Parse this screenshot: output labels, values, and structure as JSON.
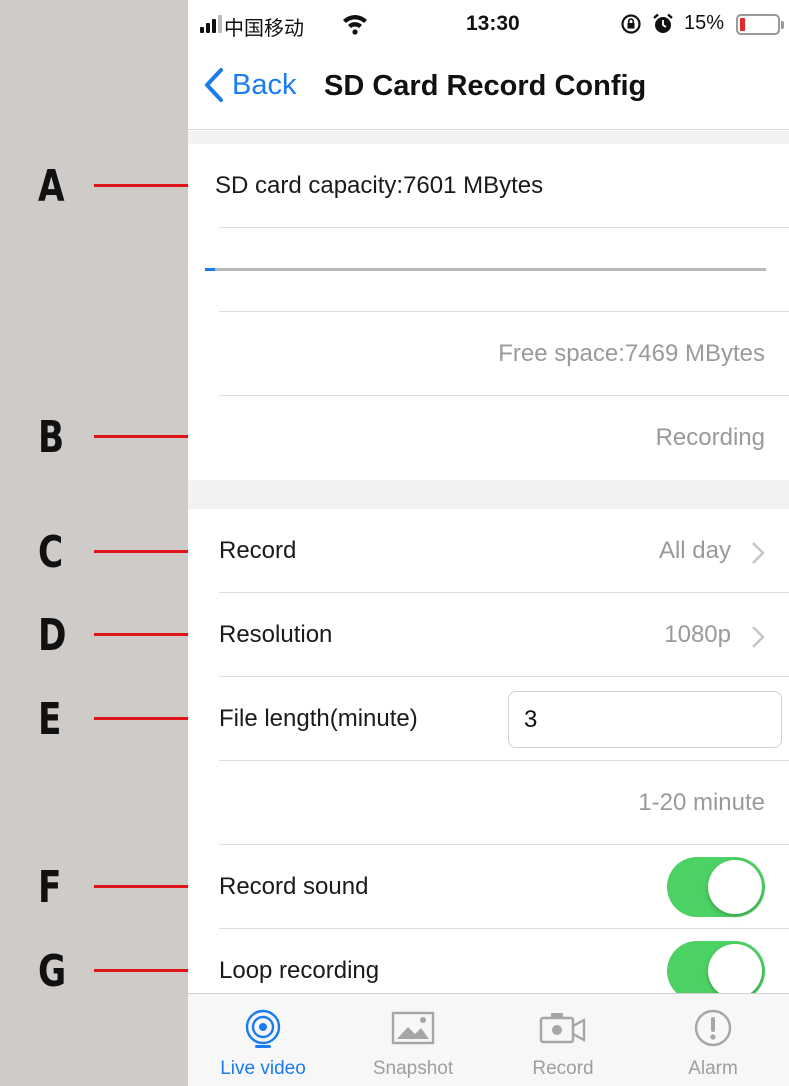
{
  "annotations": [
    "A",
    "B",
    "C",
    "D",
    "E",
    "F",
    "G"
  ],
  "status_bar": {
    "carrier": "中国移动",
    "time": "13:30",
    "battery": "15%"
  },
  "nav": {
    "back_label": "Back",
    "title": "SD Card Record Config"
  },
  "storage": {
    "capacity_label": "SD card capacity:7601 MBytes",
    "used_fraction": 0.017,
    "free_space_label": "Free space:7469 MBytes",
    "status_label": "Recording"
  },
  "settings": {
    "record": {
      "label": "Record",
      "value": "All day"
    },
    "resolution": {
      "label": "Resolution",
      "value": "1080p"
    },
    "file_length": {
      "label": "File length(minute)",
      "value": "3",
      "hint": "1-20 minute"
    },
    "record_sound": {
      "label": "Record sound",
      "on": true
    },
    "loop_recording": {
      "label": "Loop recording",
      "on": true
    }
  },
  "tabs": [
    {
      "label": "Live video",
      "icon": "live-video-icon",
      "active": true
    },
    {
      "label": "Snapshot",
      "icon": "snapshot-icon",
      "active": false
    },
    {
      "label": "Record",
      "icon": "record-camera-icon",
      "active": false
    },
    {
      "label": "Alarm",
      "icon": "alarm-icon",
      "active": false
    }
  ],
  "colors": {
    "accent": "#1a7cf0",
    "toggle_on": "#4cd164",
    "annotation_line": "#e0151b",
    "battery_low": "#e5262b"
  }
}
